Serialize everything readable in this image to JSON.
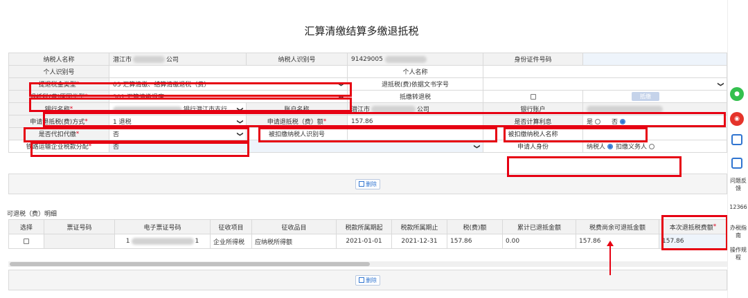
{
  "title": "汇算清缴结算多缴退抵税",
  "form": {
    "taxpayer_name_label": "纳税人名称",
    "taxpayer_name_prefix": "潜江市",
    "taxpayer_name_suffix": "公司",
    "taxpayer_id_label": "纳税人识别号",
    "taxpayer_id_value": "91429005",
    "id_doc_label": "身份证件号码",
    "personal_id_label": "个人识别号",
    "personal_name_label": "个人名称",
    "refund_type_label": "提退税金类型",
    "refund_type_value": "03 汇算清缴、结算清缴退税（费）",
    "basis_doc_label": "退抵税(费)依据文书字号",
    "reason_type_label": "退抵税(费)原因类型",
    "reason_type_value": "301 汇算清缴退库",
    "offset_label": "抵缴转退税",
    "offset_btn": "抵缴",
    "bank_name_label": "银行名称",
    "bank_name_value": "银行潜江市支行",
    "account_name_label": "账户名称",
    "account_name_prefix": "潜江市",
    "account_name_suffix": "公司",
    "bank_account_label": "银行账户",
    "apply_method_label": "申请退抵税(费)方式",
    "apply_method_value": "1 退税",
    "apply_amount_label": "申请退抵税（费）额",
    "apply_amount_value": "157.86",
    "calc_interest_label": "是否计算利息",
    "yes": "是",
    "no": "否",
    "withhold_label": "是否代扣代缴",
    "withhold_value": "否",
    "withheld_id_label": "被扣缴纳税人识别号",
    "withheld_name_label": "被扣缴纳税人名称",
    "rail_label": "铁路运输企业税款分配",
    "rail_value": "否",
    "applicant_label": "申请人身份",
    "applicant_opt1": "纳税人",
    "applicant_opt2": "扣缴义务人",
    "delete_btn": "删除"
  },
  "detail": {
    "section_title": "可退税（费）明细",
    "headers": [
      "选择",
      "票证号码",
      "电子票证号码",
      "征收项目",
      "征收品目",
      "税款所属期起",
      "税款所属期止",
      "税(费)额",
      "累计已退抵金额",
      "税费尚余可退抵金额",
      "本次退抵税费额"
    ],
    "row": {
      "ticket_no": "",
      "eticket_prefix": "1",
      "eticket_suffix": "1",
      "item": "企业所得税",
      "sub_item": "应纳税所得额",
      "period_start": "2021-01-01",
      "period_end": "2021-12-31",
      "tax_amount": "157.86",
      "refunded": "0.00",
      "remaining": "157.86",
      "this_refund": "157.86"
    },
    "delete_btn": "删除"
  },
  "sidebar": {
    "feedback": "问题反馈",
    "hotline": "12366",
    "guide": "办税指南",
    "rules": "操作规程"
  },
  "colors": {
    "highlight": "#e60012",
    "accent": "#2f74d0",
    "wechat": "#34c04e",
    "weibo": "#e5332a"
  }
}
